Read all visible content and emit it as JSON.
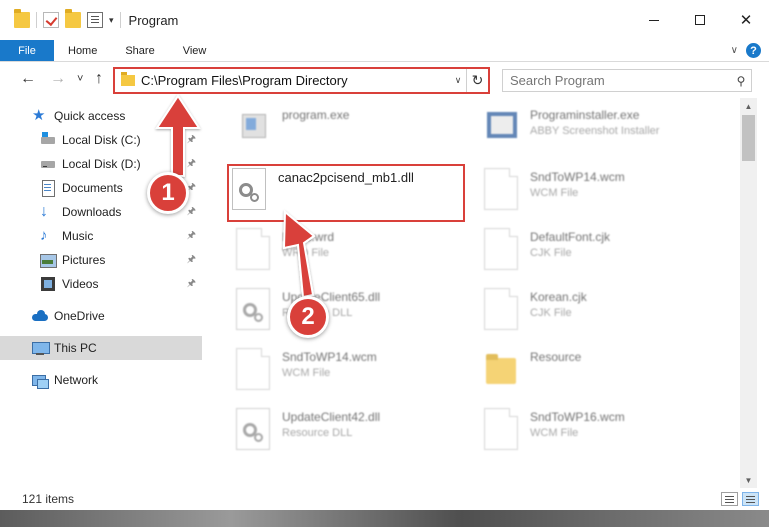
{
  "window": {
    "title": "Program",
    "controls": {
      "minimize": "minimize",
      "maximize": "maximize",
      "close": "✕"
    }
  },
  "ribbon": {
    "tabs": [
      "File",
      "Home",
      "Share",
      "View"
    ],
    "help": "?"
  },
  "address": {
    "path": "C:\\Program Files\\Program Directory",
    "refresh_glyph": "↻"
  },
  "search": {
    "placeholder": "Search Program",
    "icon": "search-icon"
  },
  "nav": {
    "back": "←",
    "forward": "→",
    "recent": "˅",
    "up": "↑"
  },
  "sidebar": {
    "items": [
      {
        "label": "Quick access",
        "icon": "star-icon",
        "pinned": false
      },
      {
        "label": "Local Disk (C:)",
        "icon": "local-disk-c-icon",
        "pinned": true
      },
      {
        "label": "Local Disk (D:)",
        "icon": "local-disk-d-icon",
        "pinned": true
      },
      {
        "label": "Documents",
        "icon": "documents-icon",
        "pinned": true
      },
      {
        "label": "Downloads",
        "icon": "downloads-icon",
        "pinned": true
      },
      {
        "label": "Music",
        "icon": "music-icon",
        "pinned": true
      },
      {
        "label": "Pictures",
        "icon": "pictures-icon",
        "pinned": true
      },
      {
        "label": "Videos",
        "icon": "videos-icon",
        "pinned": true
      },
      {
        "label": "OneDrive",
        "icon": "onedrive-icon",
        "pinned": false
      },
      {
        "label": "This PC",
        "icon": "this-pc-icon",
        "pinned": false,
        "selected": true
      },
      {
        "label": "Network",
        "icon": "network-icon",
        "pinned": false
      }
    ]
  },
  "files": [
    {
      "name": "program.exe",
      "type": "",
      "icon": "exe-icon"
    },
    {
      "name": "Programinstaller.exe",
      "type": "ABBY Screenshot Installer",
      "icon": "installer-icon"
    },
    {
      "name": "canac2pcisend_mb1.dll",
      "type": "",
      "icon": "dll-gear-icon",
      "highlighted": true
    },
    {
      "name": "SndToWP14.wcm",
      "type": "WCM File",
      "icon": "file-icon"
    },
    {
      "name": "Basic.wrd",
      "type": "WRD File",
      "icon": "file-icon"
    },
    {
      "name": "DefaultFont.cjk",
      "type": "CJK File",
      "icon": "file-icon"
    },
    {
      "name": "UpdateClient65.dll",
      "type": "Resource DLL",
      "icon": "dll-gear-icon"
    },
    {
      "name": "Korean.cjk",
      "type": "CJK File",
      "icon": "file-icon"
    },
    {
      "name": "SndToWP14.wcm",
      "type": "WCM File",
      "icon": "file-icon"
    },
    {
      "name": "Resource",
      "type": "",
      "icon": "folder-icon"
    },
    {
      "name": "UpdateClient42.dll",
      "type": "Resource DLL",
      "icon": "dll-gear-icon"
    },
    {
      "name": "SndToWP16.wcm",
      "type": "WCM File",
      "icon": "file-icon"
    }
  ],
  "status": {
    "item_count": "121 items"
  },
  "annotations": {
    "step1": "1",
    "step2": "2"
  },
  "colors": {
    "accent": "#1979ca",
    "highlight": "#d9403a",
    "selected": "#d9d9d9"
  }
}
